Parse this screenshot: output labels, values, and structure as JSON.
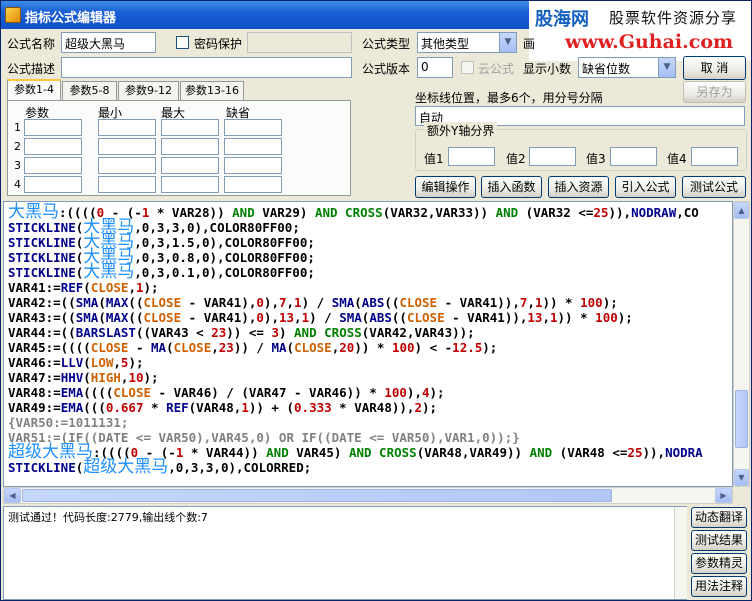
{
  "window": {
    "title": "指标公式编辑器"
  },
  "watermark": {
    "logo": "股海网",
    "slogan": "股票软件资源分享",
    "url": "www.Guhai.com"
  },
  "form": {
    "name_label": "公式名称",
    "name_value": "超级大黑马",
    "password_label": "密码保护",
    "type_label": "公式类型",
    "type_value": "其他类型",
    "draw_label": "画",
    "desc_label": "公式描述",
    "desc_value": "",
    "version_label": "公式版本",
    "version_value": "0",
    "cloud_label": "云公式",
    "decimals_label": "显示小数",
    "decimals_value": "缺省位数",
    "cancel_label": "取  消",
    "saveas_label": "另存为",
    "axis_label": "坐标线位置，最多6个，用分号分隔",
    "axis_value": "自动",
    "extra_y_label": "额外Y轴分界",
    "values": [
      "值1",
      "值2",
      "值3",
      "值4"
    ]
  },
  "param_tabs": [
    "参数1-4",
    "参数5-8",
    "参数9-12",
    "参数13-16"
  ],
  "param_grid": {
    "headers": [
      "参数",
      "最小",
      "最大",
      "缺省"
    ],
    "rows": [
      "1",
      "2",
      "3",
      "4"
    ]
  },
  "action_buttons": [
    "编辑操作",
    "插入函数",
    "插入资源",
    "引入公式",
    "测试公式"
  ],
  "code_lines": [
    [
      [
        "c-big",
        "大黑马"
      ],
      [
        "c-k",
        ":(((("
      ],
      [
        "c-r",
        "0"
      ],
      [
        "c-k",
        " - (-"
      ],
      [
        "c-r",
        "1"
      ],
      [
        "c-k",
        " * VAR28)) "
      ],
      [
        "c-g",
        "AND"
      ],
      [
        "c-k",
        " VAR29) "
      ],
      [
        "c-g",
        "AND"
      ],
      [
        "c-k",
        " "
      ],
      [
        "c-g",
        "CROSS"
      ],
      [
        "c-k",
        "(VAR32,VAR33)) "
      ],
      [
        "c-g",
        "AND"
      ],
      [
        "c-k",
        " (VAR32 <="
      ],
      [
        "c-r",
        "25"
      ],
      [
        "c-k",
        ")),"
      ],
      [
        "c-b",
        "NODRAW"
      ],
      [
        "c-k",
        ",CO"
      ]
    ],
    [
      [
        "c-b",
        "STICKLINE"
      ],
      [
        "c-k",
        "("
      ],
      [
        "c-big",
        "大黑马"
      ],
      [
        "c-k",
        ","
      ],
      [
        "c-k",
        "0,3,3,0"
      ],
      [
        "c-k",
        "),"
      ],
      [
        "c-k",
        "COLOR80FF00;"
      ]
    ],
    [
      [
        "c-b",
        "STICKLINE"
      ],
      [
        "c-k",
        "("
      ],
      [
        "c-big",
        "大黑马"
      ],
      [
        "c-k",
        ",0,3,1.5,0),COLOR80FF00;"
      ]
    ],
    [
      [
        "c-b",
        "STICKLINE"
      ],
      [
        "c-k",
        "("
      ],
      [
        "c-big",
        "大黑马"
      ],
      [
        "c-k",
        ",0,3,0.8,0),COLOR80FF00;"
      ]
    ],
    [
      [
        "c-b",
        "STICKLINE"
      ],
      [
        "c-k",
        "("
      ],
      [
        "c-big",
        "大黑马"
      ],
      [
        "c-k",
        ",0,3,0.1,0),COLOR80FF00;"
      ]
    ],
    [
      [
        "c-k",
        "VAR41:="
      ],
      [
        "c-b",
        "REF"
      ],
      [
        "c-k",
        "("
      ],
      [
        "c-o",
        "CLOSE"
      ],
      [
        "c-k",
        ","
      ],
      [
        "c-r",
        "1"
      ],
      [
        "c-k",
        ");"
      ]
    ],
    [
      [
        "c-k",
        "VAR42:=(("
      ],
      [
        "c-b",
        "SMA"
      ],
      [
        "c-k",
        "("
      ],
      [
        "c-b",
        "MAX"
      ],
      [
        "c-k",
        "(("
      ],
      [
        "c-o",
        "CLOSE"
      ],
      [
        "c-k",
        " - VAR41),"
      ],
      [
        "c-r",
        "0"
      ],
      [
        "c-k",
        "),"
      ],
      [
        "c-r",
        "7"
      ],
      [
        "c-k",
        ","
      ],
      [
        "c-r",
        "1"
      ],
      [
        "c-k",
        ") / "
      ],
      [
        "c-b",
        "SMA"
      ],
      [
        "c-k",
        "("
      ],
      [
        "c-b",
        "ABS"
      ],
      [
        "c-k",
        "(("
      ],
      [
        "c-o",
        "CLOSE"
      ],
      [
        "c-k",
        " - VAR41)),"
      ],
      [
        "c-r",
        "7"
      ],
      [
        "c-k",
        ","
      ],
      [
        "c-r",
        "1"
      ],
      [
        "c-k",
        ")) * "
      ],
      [
        "c-r",
        "100"
      ],
      [
        "c-k",
        ");"
      ]
    ],
    [
      [
        "c-k",
        "VAR43:=(("
      ],
      [
        "c-b",
        "SMA"
      ],
      [
        "c-k",
        "("
      ],
      [
        "c-b",
        "MAX"
      ],
      [
        "c-k",
        "(("
      ],
      [
        "c-o",
        "CLOSE"
      ],
      [
        "c-k",
        " - VAR41),"
      ],
      [
        "c-r",
        "0"
      ],
      [
        "c-k",
        "),"
      ],
      [
        "c-r",
        "13"
      ],
      [
        "c-k",
        ","
      ],
      [
        "c-r",
        "1"
      ],
      [
        "c-k",
        ") / "
      ],
      [
        "c-b",
        "SMA"
      ],
      [
        "c-k",
        "("
      ],
      [
        "c-b",
        "ABS"
      ],
      [
        "c-k",
        "(("
      ],
      [
        "c-o",
        "CLOSE"
      ],
      [
        "c-k",
        " - VAR41)),"
      ],
      [
        "c-r",
        "13"
      ],
      [
        "c-k",
        ","
      ],
      [
        "c-r",
        "1"
      ],
      [
        "c-k",
        ")) * "
      ],
      [
        "c-r",
        "100"
      ],
      [
        "c-k",
        ");"
      ]
    ],
    [
      [
        "c-k",
        "VAR44:=(("
      ],
      [
        "c-b",
        "BARSLAST"
      ],
      [
        "c-k",
        "((VAR43 < "
      ],
      [
        "c-r",
        "23"
      ],
      [
        "c-k",
        ")) <= "
      ],
      [
        "c-r",
        "3"
      ],
      [
        "c-k",
        ") "
      ],
      [
        "c-g",
        "AND"
      ],
      [
        "c-k",
        " "
      ],
      [
        "c-g",
        "CROSS"
      ],
      [
        "c-k",
        "(VAR42,VAR43));"
      ]
    ],
    [
      [
        "c-k",
        "VAR45:=(((("
      ],
      [
        "c-o",
        "CLOSE"
      ],
      [
        "c-k",
        " - "
      ],
      [
        "c-b",
        "MA"
      ],
      [
        "c-k",
        "("
      ],
      [
        "c-o",
        "CLOSE"
      ],
      [
        "c-k",
        ","
      ],
      [
        "c-r",
        "23"
      ],
      [
        "c-k",
        ")) / "
      ],
      [
        "c-b",
        "MA"
      ],
      [
        "c-k",
        "("
      ],
      [
        "c-o",
        "CLOSE"
      ],
      [
        "c-k",
        ","
      ],
      [
        "c-r",
        "20"
      ],
      [
        "c-k",
        ")) * "
      ],
      [
        "c-r",
        "100"
      ],
      [
        "c-k",
        ") < -"
      ],
      [
        "c-r",
        "12.5"
      ],
      [
        "c-k",
        ");"
      ]
    ],
    [
      [
        "c-k",
        "VAR46:="
      ],
      [
        "c-b",
        "LLV"
      ],
      [
        "c-k",
        "("
      ],
      [
        "c-o",
        "LOW"
      ],
      [
        "c-k",
        ","
      ],
      [
        "c-r",
        "5"
      ],
      [
        "c-k",
        ");"
      ]
    ],
    [
      [
        "c-k",
        "VAR47:="
      ],
      [
        "c-b",
        "HHV"
      ],
      [
        "c-k",
        "("
      ],
      [
        "c-o",
        "HIGH"
      ],
      [
        "c-k",
        ","
      ],
      [
        "c-r",
        "10"
      ],
      [
        "c-k",
        ");"
      ]
    ],
    [
      [
        "c-k",
        "VAR48:="
      ],
      [
        "c-b",
        "EMA"
      ],
      [
        "c-k",
        "(((("
      ],
      [
        "c-o",
        "CLOSE"
      ],
      [
        "c-k",
        " - VAR46) / (VAR47 - VAR46)) * "
      ],
      [
        "c-r",
        "100"
      ],
      [
        "c-k",
        "),"
      ],
      [
        "c-r",
        "4"
      ],
      [
        "c-k",
        ");"
      ]
    ],
    [
      [
        "c-k",
        "VAR49:="
      ],
      [
        "c-b",
        "EMA"
      ],
      [
        "c-k",
        "((("
      ],
      [
        "c-r",
        "0.667"
      ],
      [
        "c-k",
        " * "
      ],
      [
        "c-b",
        "REF"
      ],
      [
        "c-k",
        "(VAR48,"
      ],
      [
        "c-r",
        "1"
      ],
      [
        "c-k",
        ")) + ("
      ],
      [
        "c-r",
        "0.333"
      ],
      [
        "c-k",
        " * VAR48)),"
      ],
      [
        "c-r",
        "2"
      ],
      [
        "c-k",
        ");"
      ]
    ],
    [
      [
        "c-gray",
        "{VAR50:=1011131;"
      ]
    ],
    [
      [
        "c-gray",
        "VAR51:=(IF((DATE <= VAR50),VAR45,0) OR IF((DATE <= VAR50),VAR1,0));}"
      ]
    ],
    [
      [
        "c-big",
        "超级大黑马"
      ],
      [
        "c-k",
        ":(((("
      ],
      [
        "c-r",
        "0"
      ],
      [
        "c-k",
        " - (-"
      ],
      [
        "c-r",
        "1"
      ],
      [
        "c-k",
        " * VAR44)) "
      ],
      [
        "c-g",
        "AND"
      ],
      [
        "c-k",
        " VAR45) "
      ],
      [
        "c-g",
        "AND"
      ],
      [
        "c-k",
        " "
      ],
      [
        "c-g",
        "CROSS"
      ],
      [
        "c-k",
        "(VAR48,VAR49)) "
      ],
      [
        "c-g",
        "AND"
      ],
      [
        "c-k",
        " (VAR48 <="
      ],
      [
        "c-r",
        "25"
      ],
      [
        "c-k",
        ")),"
      ],
      [
        "c-b",
        "NODRA"
      ]
    ],
    [
      [
        "c-b",
        "STICKLINE"
      ],
      [
        "c-k",
        "("
      ],
      [
        "c-big",
        "超级大黑马"
      ],
      [
        "c-k",
        ",0,3,3,0),COLORRED;"
      ]
    ]
  ],
  "status_text": "测试通过！代码长度:2779,输出线个数:7",
  "side_buttons": [
    "动态翻译",
    "测试结果",
    "参数精灵",
    "用法注释"
  ]
}
